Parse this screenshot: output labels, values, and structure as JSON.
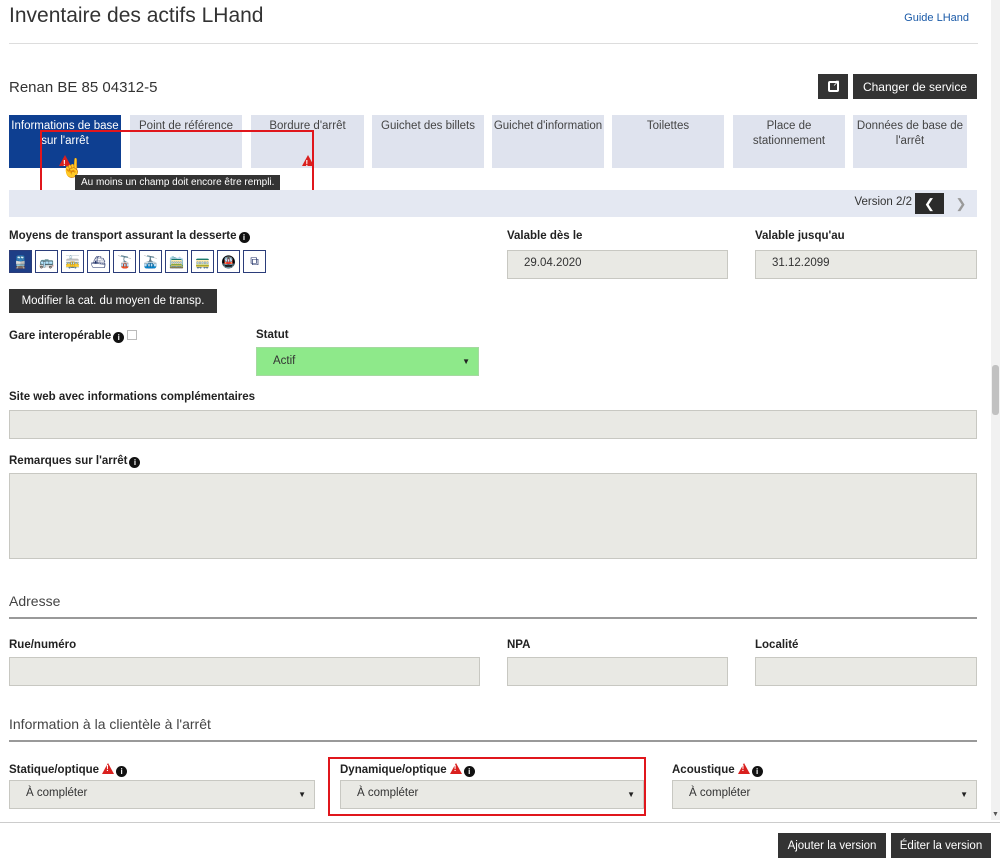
{
  "header": {
    "title": "Inventaire des actifs LHand",
    "guide_link": "Guide LHand"
  },
  "stop": {
    "name": "Renan BE 85 04312-5",
    "change_service_label": "Changer de service"
  },
  "tabs": [
    {
      "line1": "Informations de base",
      "line2": "sur l'arrêt",
      "active": true,
      "warning": true
    },
    {
      "line1": "Point de référence",
      "line2": "",
      "active": false,
      "warning": false
    },
    {
      "line1": "Bordure d'arrêt",
      "line2": "",
      "active": false,
      "warning": true
    },
    {
      "line1": "Guichet des billets",
      "line2": "",
      "active": false,
      "warning": false
    },
    {
      "line1": "Guichet d'information",
      "line2": "",
      "active": false,
      "warning": false
    },
    {
      "line1": "Toilettes",
      "line2": "",
      "active": false,
      "warning": false
    },
    {
      "line1": "Place de",
      "line2": "stationnement",
      "active": false,
      "warning": false
    },
    {
      "line1": "Données de base de",
      "line2": "l'arrêt",
      "active": false,
      "warning": false
    }
  ],
  "tooltip": "Au moins un champ doit encore être rempli.",
  "version": {
    "label": "Version 2/2"
  },
  "transport": {
    "label": "Moyens de transport assurant la desserte",
    "modify_label": "Modifier la cat. du moyen de transp.",
    "icons": [
      "train-icon",
      "bus-icon",
      "tram-icon",
      "boat-icon",
      "cable-car-icon",
      "chairlift-icon",
      "rack-railway-icon",
      "funicular-icon",
      "metro-icon",
      "elevator-icon"
    ]
  },
  "validity": {
    "from_label": "Valable dès le",
    "from_value": "29.04.2020",
    "to_label": "Valable jusqu'au",
    "to_value": "31.12.2099"
  },
  "interop": {
    "label": "Gare interopérable"
  },
  "status": {
    "label": "Statut",
    "value": "Actif"
  },
  "website": {
    "label": "Site web avec informations complémentaires",
    "value": ""
  },
  "remarks": {
    "label": "Remarques sur l'arrêt",
    "value": ""
  },
  "address": {
    "section_title": "Adresse",
    "street_label": "Rue/numéro",
    "npa_label": "NPA",
    "locality_label": "Localité"
  },
  "customer_info": {
    "section_title": "Information à la clientèle à l'arrêt",
    "static_label": "Statique/optique",
    "static_value": "À compléter",
    "dynamic_label": "Dynamique/optique",
    "dynamic_value": "À compléter",
    "acoustic_label": "Acoustique",
    "acoustic_value": "À compléter"
  },
  "footer": {
    "add_version_label": "Ajouter la version",
    "edit_version_label": "Éditer la version"
  },
  "colors": {
    "active_tab": "#0e3f91",
    "status_active": "#8ee98a",
    "warning": "#d9201e",
    "highlight_box": "#e0161c"
  }
}
